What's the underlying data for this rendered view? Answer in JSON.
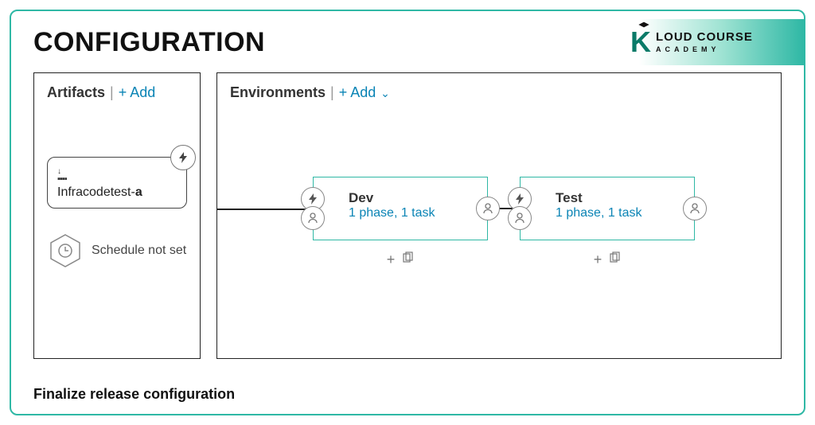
{
  "title": "CONFIGURATION",
  "logo": {
    "line1": "LOUD COURSE",
    "line2": "ACADEMY"
  },
  "artifacts": {
    "header": "Artifacts",
    "add_label": "+ Add",
    "item_prefix": "Infracodetest-",
    "item_suffix": "a",
    "schedule_label": "Schedule not set"
  },
  "environments": {
    "header": "Environments",
    "add_label": "+ Add",
    "items": [
      {
        "name": "Dev",
        "meta": "1 phase, 1 task"
      },
      {
        "name": "Test",
        "meta": "1 phase, 1 task"
      }
    ],
    "add_action": "+",
    "clone_action": "⎘"
  },
  "footer": "Finalize release configuration"
}
